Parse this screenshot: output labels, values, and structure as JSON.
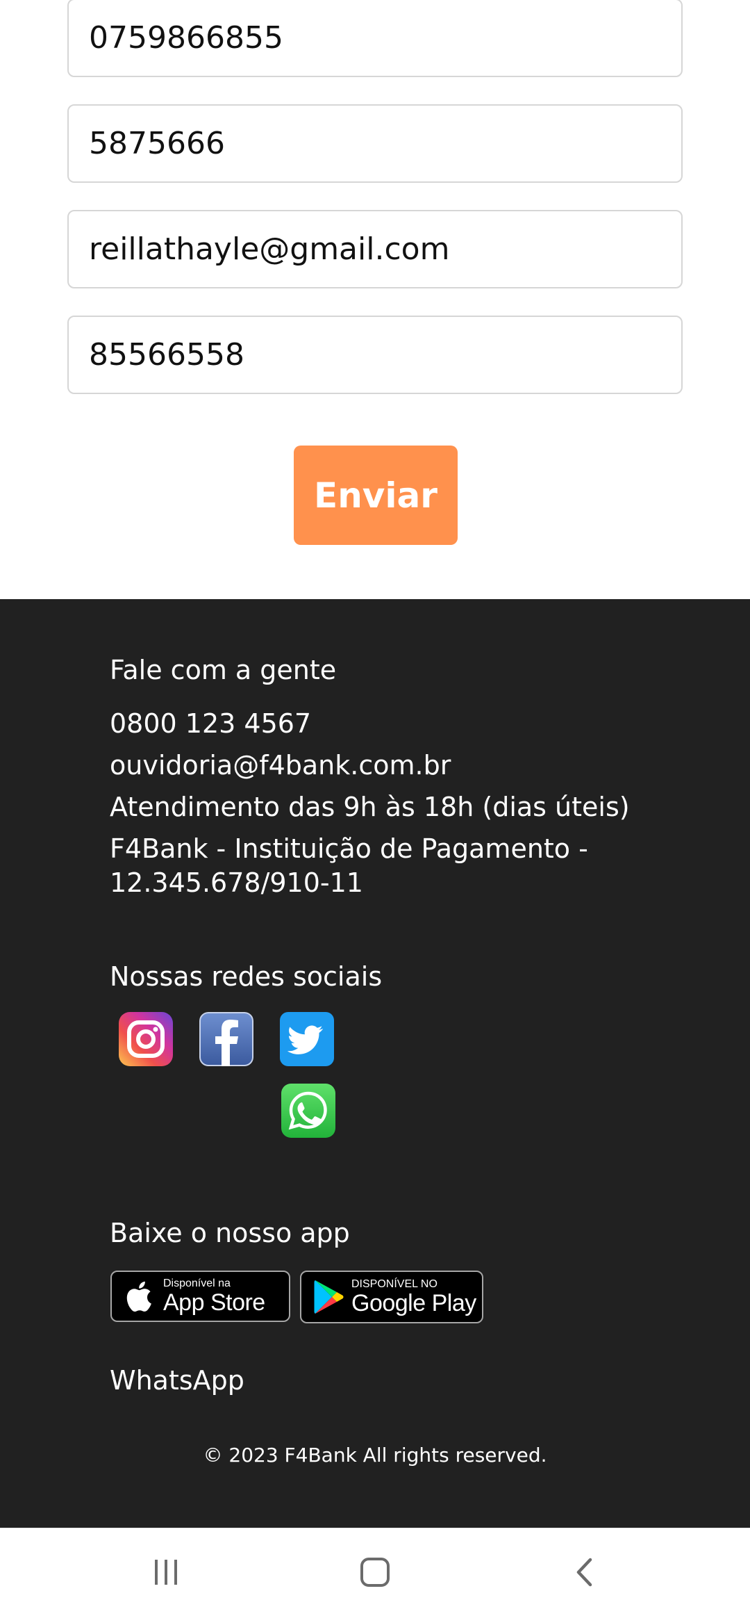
{
  "form": {
    "fields": [
      {
        "value": "0759866855"
      },
      {
        "value": "5875666"
      },
      {
        "value": "reillathayle@gmail.com"
      },
      {
        "value": "85566558"
      }
    ],
    "submit_label": "Enviar",
    "accent_color": "#ff914d"
  },
  "footer": {
    "background_color": "#212121",
    "contact": {
      "heading": "Fale com a gente",
      "phone": "0800 123 4567",
      "email": "ouvidoria@f4bank.com.br",
      "hours": "Atendimento das 9h às 18h (dias úteis)",
      "company_line1": "F4Bank - Instituição de Pagamento -",
      "company_line2": "12.345.678/910-11"
    },
    "social": {
      "heading": "Nossas redes sociais",
      "icons": [
        "instagram-icon",
        "facebook-icon",
        "twitter-icon",
        "whatsapp-icon"
      ],
      "whatsapp_label": "WhatsApp"
    },
    "app": {
      "heading": "Baixe o nosso app",
      "app_store": {
        "small": "Disponível na",
        "big": "App Store"
      },
      "google_play": {
        "small": "DISPONÍVEL NO",
        "big": "Google Play"
      }
    },
    "copyright": "© 2023 F4Bank All rights reserved."
  },
  "navbar": {
    "icons": [
      "recent-apps-icon",
      "home-icon",
      "back-icon"
    ]
  }
}
